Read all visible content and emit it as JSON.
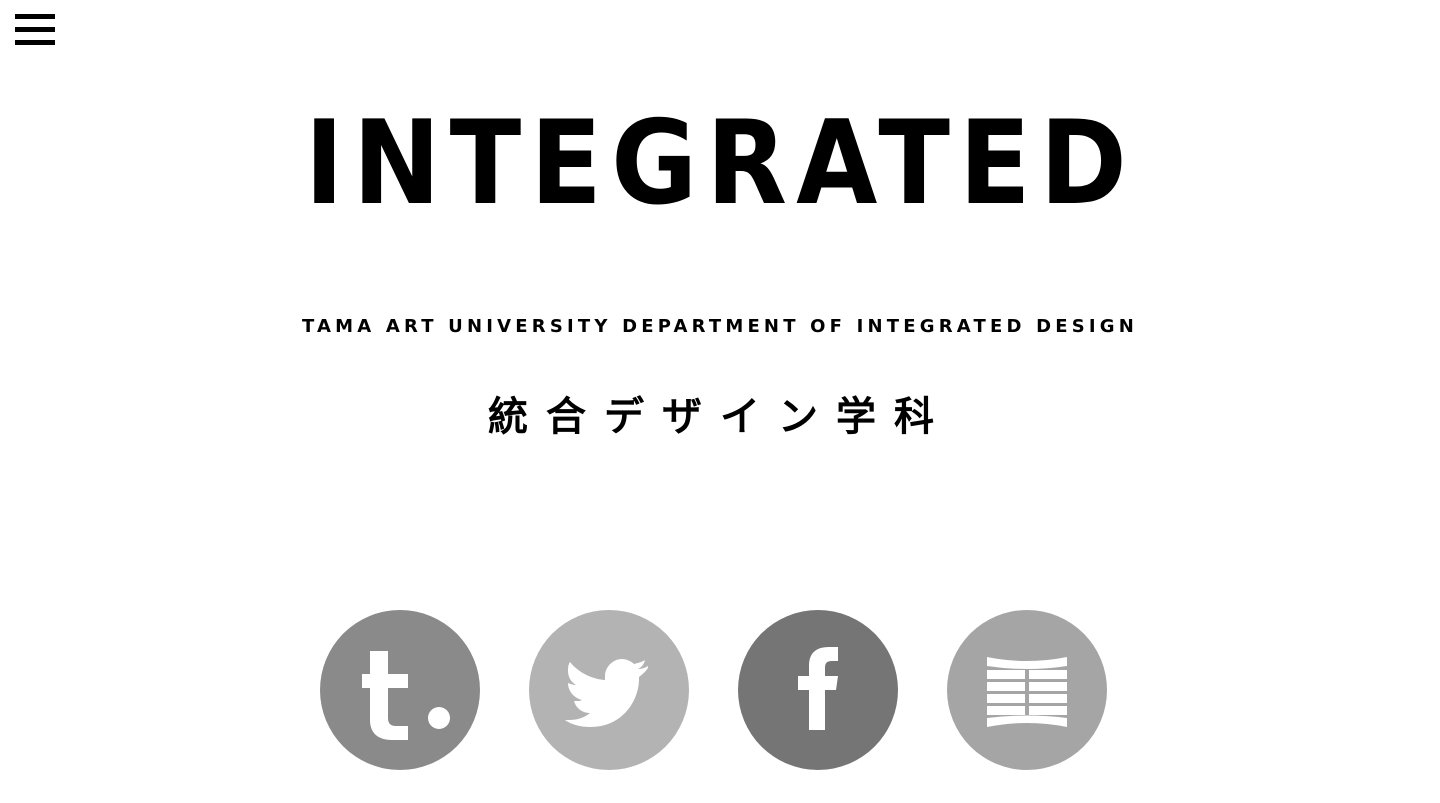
{
  "header": {
    "menu_icon": "hamburger-menu-icon"
  },
  "hero": {
    "wordmark": "INTEGRATED",
    "subtitle": "TAMA ART UNIVERSITY  DEPARTMENT OF INTEGRATED DESIGN",
    "jp_title": "統合デザイン学科"
  },
  "social": {
    "items": [
      {
        "icon": "tumblr-icon",
        "color": "#8a8a8a"
      },
      {
        "icon": "twitter-icon",
        "color": "#b3b3b3"
      },
      {
        "icon": "facebook-icon",
        "color": "#757575"
      },
      {
        "icon": "grid-logo-icon",
        "color": "#a5a5a5"
      }
    ]
  },
  "colors": {
    "background": "#ffffff",
    "text": "#000000",
    "icon_glyph": "#ffffff"
  }
}
